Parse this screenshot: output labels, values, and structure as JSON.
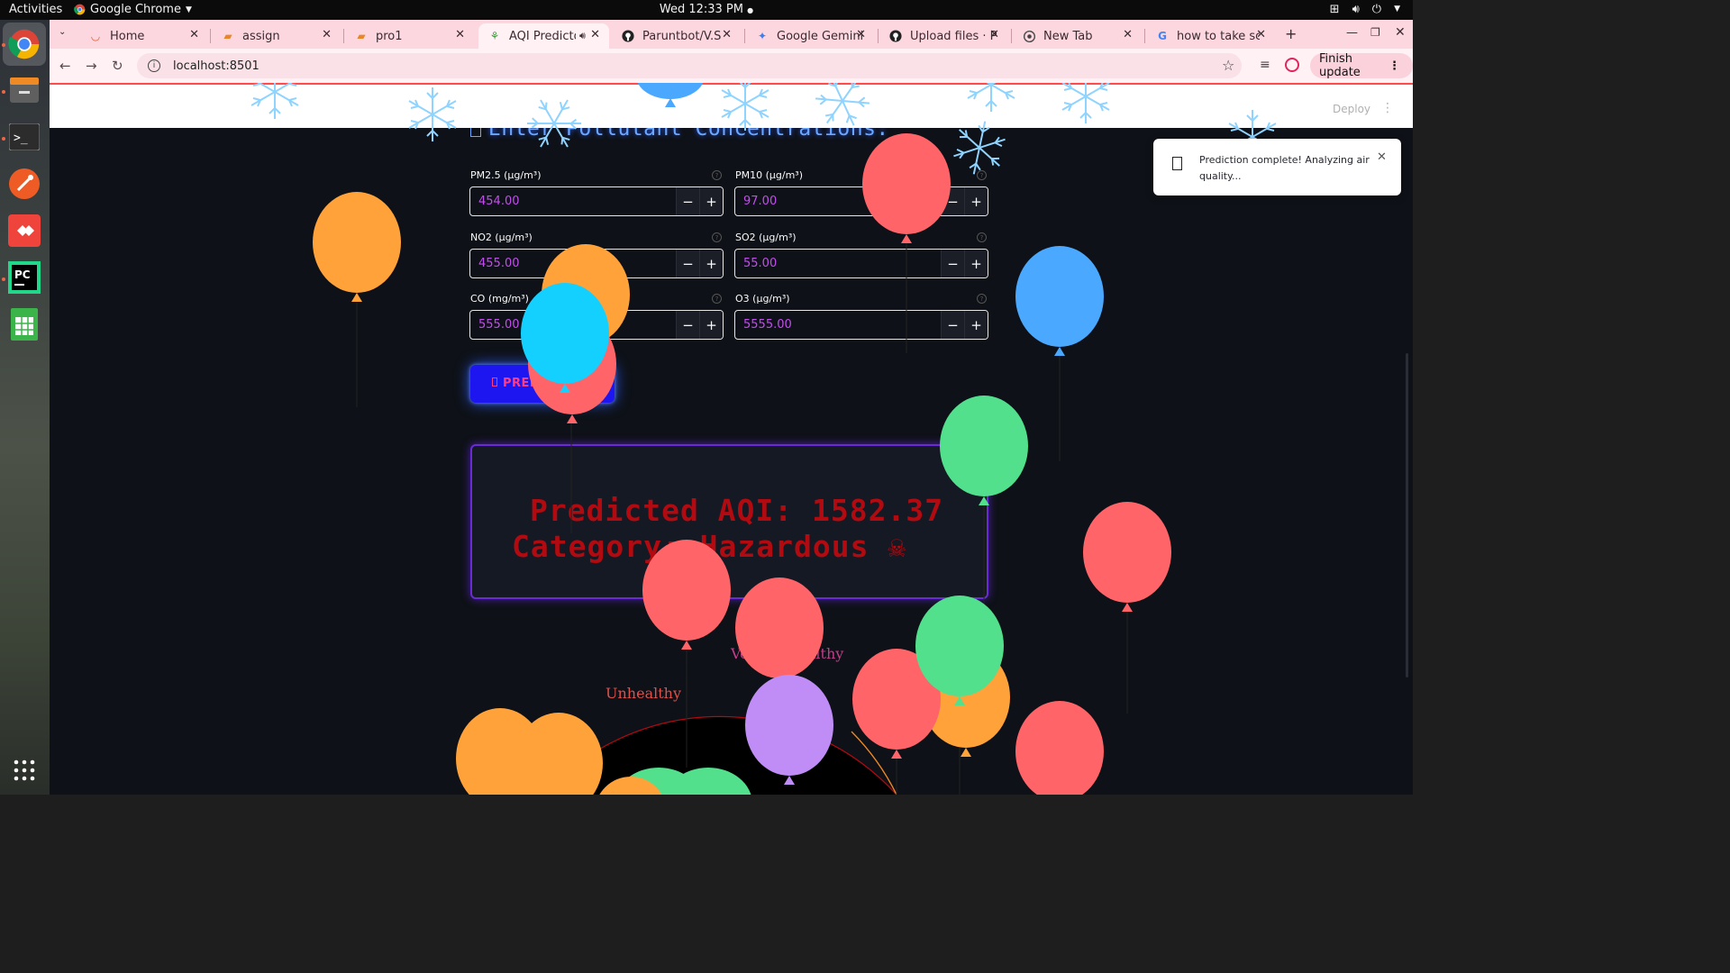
{
  "topbar": {
    "activities": "Activities",
    "app_name": "Google Chrome",
    "clock": "Wed 12:33 PM"
  },
  "dock": {
    "items": [
      "chrome-icon",
      "files-icon",
      "terminal-icon",
      "postman-icon",
      "anydesk-icon",
      "pycharm-icon",
      "spreadsheet-icon",
      "app-grid-icon"
    ]
  },
  "browser": {
    "tabs": [
      {
        "title": "Home",
        "icon": "loading-icon"
      },
      {
        "title": "assign",
        "icon": "document-icon"
      },
      {
        "title": "pro1",
        "icon": "document-icon"
      },
      {
        "title": "AQI Predicto",
        "icon": "streamlit-icon",
        "active": true
      },
      {
        "title": "Paruntbot/V.S",
        "icon": "github-icon"
      },
      {
        "title": "Google Gemini",
        "icon": "gemini-icon"
      },
      {
        "title": "Upload files · Pa",
        "icon": "github-icon"
      },
      {
        "title": "New Tab",
        "icon": "chrome-icon"
      },
      {
        "title": "how to take scre",
        "icon": "google-icon"
      }
    ],
    "new_tab": "+",
    "url": "localhost:8501",
    "finish_update": "Finish update"
  },
  "app": {
    "deploy": "Deploy",
    "section_heading": "Enter Pollutant Concentrations:",
    "fields": [
      {
        "label": "PM2.5 (µg/m³)",
        "value": "454.00"
      },
      {
        "label": "PM10 (µg/m³)",
        "value": "97.00"
      },
      {
        "label": "NO2 (µg/m³)",
        "value": "455.00"
      },
      {
        "label": "SO2 (µg/m³)",
        "value": "55.00"
      },
      {
        "label": "CO (mg/m³)",
        "value": "555.00"
      },
      {
        "label": "O3 (µg/m³)",
        "value": "5555.00"
      }
    ],
    "predict_button": "PREDI",
    "result_line1": "Predicted AQI: 1582.37",
    "result_line2": "Category: Hazardous ☠",
    "gauge_labels": {
      "unhealthy": "Unhealthy",
      "very_unhealthy": "Very Unhealthy"
    },
    "toast": "Prediction complete! Analyzing air quality..."
  },
  "colors": {
    "accent_blue": "#1d16f0",
    "result_red": "#b10a10",
    "input_value": "#c44df0",
    "tab_strip": "#fdd7e0"
  }
}
